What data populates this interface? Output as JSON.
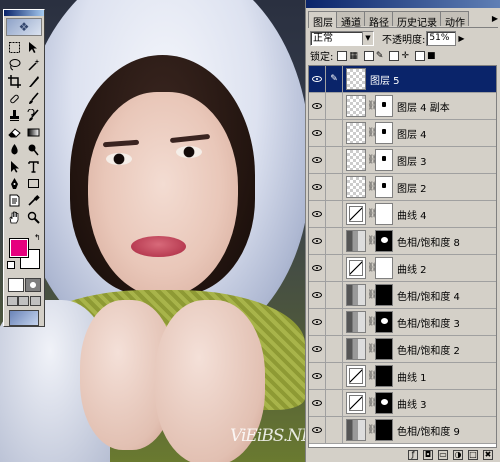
{
  "photo": {
    "watermark": "ViEiBS.NET"
  },
  "toolbox": {
    "tools": [
      "marquee-icon",
      "move-icon",
      "lasso-icon",
      "magic-wand-icon",
      "crop-icon",
      "slice-icon",
      "healing-brush-icon",
      "brush-icon",
      "clone-stamp-icon",
      "history-brush-icon",
      "eraser-icon",
      "gradient-icon",
      "blur-icon",
      "dodge-icon",
      "path-selection-icon",
      "type-icon",
      "pen-icon",
      "shape-icon",
      "notes-icon",
      "eyedropper-icon",
      "hand-icon",
      "zoom-icon"
    ],
    "foreground_color": "#e6007e",
    "background_color": "#ffffff"
  },
  "panel": {
    "tabs": [
      "图层",
      "通道",
      "路径",
      "历史记录",
      "动作"
    ],
    "blend_mode": "正常",
    "opacity_label": "不透明度:",
    "opacity_value": "51%",
    "lock_label": "锁定:",
    "layers": [
      {
        "name": "图层 5",
        "thumb": "checker",
        "mask": "none",
        "selected": true,
        "brush": true
      },
      {
        "name": "图层 4 副本",
        "thumb": "checker",
        "mask": "white",
        "selected": false
      },
      {
        "name": "图层 4",
        "thumb": "checker",
        "mask": "white",
        "selected": false
      },
      {
        "name": "图层 3",
        "thumb": "checker",
        "mask": "white",
        "selected": false
      },
      {
        "name": "图层 2",
        "thumb": "checker",
        "mask": "white",
        "selected": false
      },
      {
        "name": "曲线 4",
        "thumb": "curve",
        "mask": "white",
        "selected": false
      },
      {
        "name": "色相/饱和度 8",
        "thumb": "hue",
        "mask": "black",
        "selected": false
      },
      {
        "name": "曲线 2",
        "thumb": "curve",
        "mask": "white",
        "selected": false
      },
      {
        "name": "色相/饱和度 4",
        "thumb": "hue",
        "mask": "black",
        "selected": false
      },
      {
        "name": "色相/饱和度 3",
        "thumb": "hue",
        "mask": "black",
        "selected": false
      },
      {
        "name": "色相/饱和度 2",
        "thumb": "hue",
        "mask": "black",
        "selected": false
      },
      {
        "name": "曲线 1",
        "thumb": "curve",
        "mask": "black",
        "selected": false
      },
      {
        "name": "曲线 3",
        "thumb": "curve",
        "mask": "black",
        "selected": false
      },
      {
        "name": "色相/饱和度 9",
        "thumb": "hue",
        "mask": "black",
        "selected": false
      }
    ],
    "bottom_icons": [
      "layer-style-icon",
      "add-mask-icon",
      "new-set-icon",
      "adjustment-layer-icon",
      "new-layer-icon",
      "delete-layer-icon"
    ]
  }
}
